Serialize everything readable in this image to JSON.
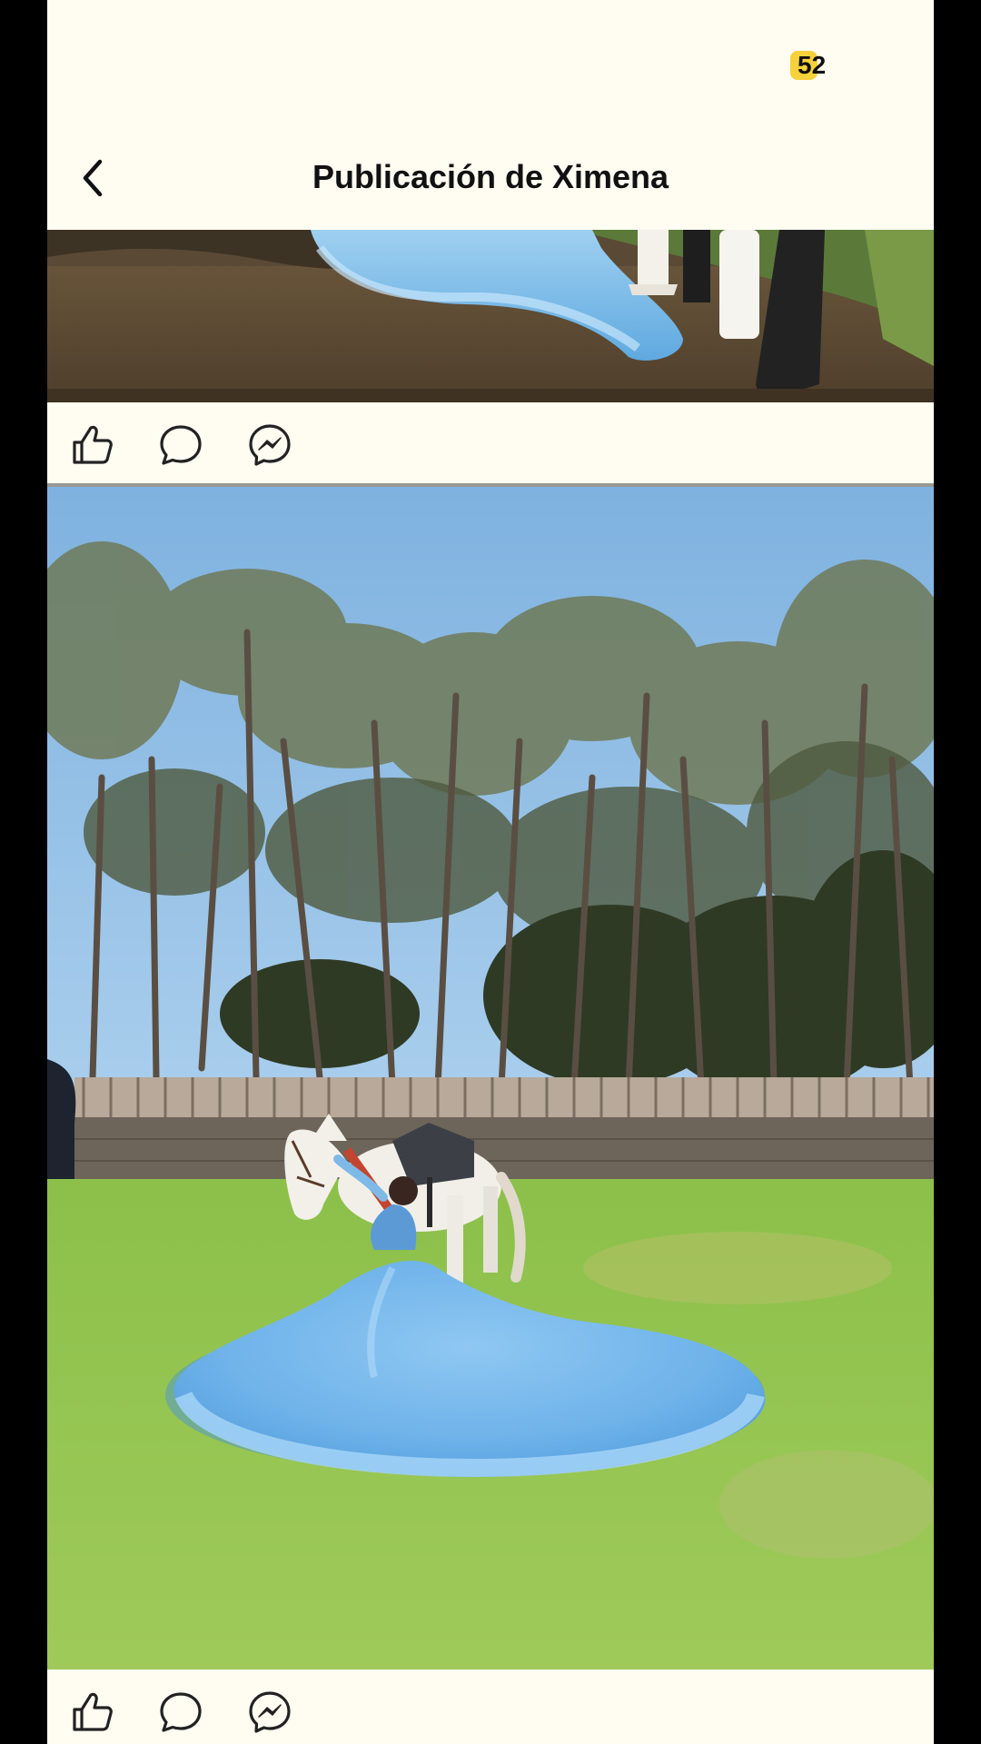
{
  "status_bar": {
    "battery_level": "52"
  },
  "header": {
    "title": "Publicación de Ximena"
  },
  "icons": {
    "back": "chevron-left-icon",
    "like": "thumbs-up-icon",
    "comment": "comment-bubble-icon",
    "share": "messenger-icon"
  },
  "colors": {
    "background": "#fffcf2",
    "battery_fill": "#f6d13a",
    "text": "#111111",
    "divider": "#9a9894"
  }
}
